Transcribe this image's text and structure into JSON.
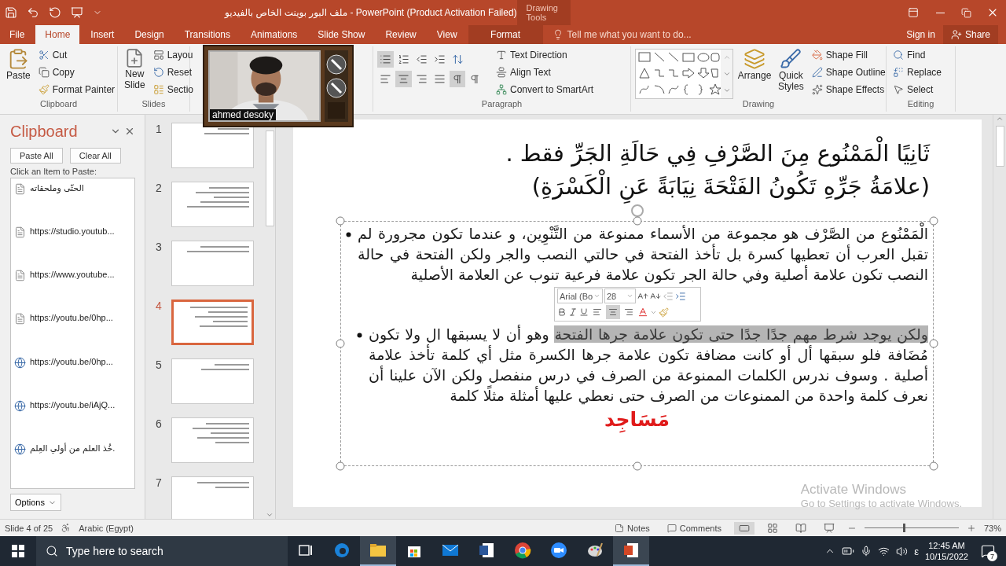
{
  "window": {
    "title": "ملف البور بوينت الخاص بالفيديو - PowerPoint (Product Activation Failed)",
    "context_group": "Drawing Tools"
  },
  "tabs": [
    {
      "label": "File",
      "kind": "file",
      "selected": false
    },
    {
      "label": "Home",
      "kind": "normal",
      "selected": true
    },
    {
      "label": "Insert",
      "kind": "normal",
      "selected": false
    },
    {
      "label": "Design",
      "kind": "normal",
      "selected": false
    },
    {
      "label": "Transitions",
      "kind": "normal",
      "selected": false
    },
    {
      "label": "Animations",
      "kind": "normal",
      "selected": false
    },
    {
      "label": "Slide Show",
      "kind": "normal",
      "selected": false
    },
    {
      "label": "Review",
      "kind": "normal",
      "selected": false
    },
    {
      "label": "View",
      "kind": "normal",
      "selected": false
    },
    {
      "label": "Format",
      "kind": "context",
      "selected": false
    }
  ],
  "tell_me": "Tell me what you want to do...",
  "account": {
    "sign_in": "Sign in",
    "share": "Share"
  },
  "ribbon": {
    "clipboard": {
      "label": "Clipboard",
      "paste": "Paste",
      "cut": "Cut",
      "copy": "Copy",
      "format_painter": "Format Painter"
    },
    "slides": {
      "label": "Slides",
      "new_slide": "New Slide",
      "layout": "Layou",
      "reset": "Reset",
      "section": "Sectio"
    },
    "paragraph": {
      "label": "Paragraph",
      "bullets_on": true,
      "alignments": [
        {
          "selected": false
        },
        {
          "selected": true
        },
        {
          "selected": false
        },
        {
          "selected": false
        }
      ],
      "directions": [
        {
          "selected": true
        },
        {
          "selected": false
        }
      ],
      "text_direction": "Text Direction",
      "align_text": "Align Text",
      "smartart": "Convert to SmartArt"
    },
    "drawing": {
      "label": "Drawing",
      "arrange": "Arrange",
      "quick_styles": "Quick Styles",
      "shape_fill": "Shape Fill",
      "shape_outline": "Shape Outline",
      "shape_effects": "Shape Effects"
    },
    "editing": {
      "label": "Editing",
      "find": "Find",
      "replace": "Replace",
      "select": "Select"
    }
  },
  "webcam": {
    "name": "ahmed desoky"
  },
  "clipboard_pane": {
    "title": "Clipboard",
    "paste_all": "Paste All",
    "clear_all": "Clear All",
    "hint": "Click an Item to Paste:",
    "options": "Options",
    "items": [
      {
        "kind": "text",
        "label": "الحتّى وملحقاته"
      },
      {
        "kind": "text",
        "label": "https://studio.youtub..."
      },
      {
        "kind": "text",
        "label": "https://www.youtube..."
      },
      {
        "kind": "text",
        "label": "https://youtu.be/0hp..."
      },
      {
        "kind": "web",
        "label": "https://youtu.be/0hp..."
      },
      {
        "kind": "web",
        "label": "https://youtu.be/iAjQ..."
      },
      {
        "kind": "web",
        "label": "خُذ العلم من أولي العِلم."
      }
    ]
  },
  "slides": [
    {
      "number": "1",
      "selected": false
    },
    {
      "number": "2",
      "selected": false
    },
    {
      "number": "3",
      "selected": false
    },
    {
      "number": "4",
      "selected": true
    },
    {
      "number": "5",
      "selected": false
    },
    {
      "number": "6",
      "selected": false
    },
    {
      "number": "7",
      "selected": false
    }
  ],
  "slide": {
    "title_lines": [
      "ثَانِيًا الْمَمْنُوع مِنَ الصَّرْفِ فِي حَالَةِ الجَرِّ فقط .",
      "(علامَةُ جَرِّهِ تَكُونُ الفَتْحَةَ نِيَابَةً عَنِ الْكَسْرَةِ)"
    ],
    "bullets": [
      {
        "text": "الْمَمْنُوع من الصَّرْف هو مجموعة من الأسماء ممنوعة من التَّنْوِين، و عندما تكون مجرورة لم تقبل العرب أن تعطيها كسرة بل تأخذ الفتحة في حالتي النصب والجر ولكن الفتحة في حالة النصب تكون علامة أصلية وفي حالة الجر تكون علامة فرعية تنوب عن العلامة الأصلية"
      },
      {
        "selected_text": "ولكن يوجد شرط مهم جدًا جدًا حتى تكون علامة جرها الفتحة",
        "text": " وهو أن لا يسبقها ال ولا تكون مُضَافة فلو سبقها أل أو كانت مضافة تكون علامة جرها الكسرة مثل أي كلمة تأخذ علامة أصلية . وسوف ندرس الكلمات الممنوعة من الصرف في درس منفصل ولكن الآن علينا أن نعرف كلمة واحدة من الممنوعات من الصرف حتى نعطي عليها أمثلة مثلًا كلمة"
      }
    ],
    "example_word": "مَسَاجِد"
  },
  "mini_toolbar": {
    "font": "Arial (Bo",
    "size": "28",
    "alignments": [
      {
        "selected": false
      },
      {
        "selected": true
      },
      {
        "selected": false
      }
    ]
  },
  "activation_notice": {
    "title": "Activate Windows",
    "subtitle": "Go to Settings to activate Windows."
  },
  "status_bar": {
    "slide": "Slide 4 of 25",
    "language": "Arabic (Egypt)",
    "notes": "Notes",
    "comments": "Comments",
    "zoom": "73%",
    "zoom_slider": {
      "level": 0.41
    }
  },
  "taskbar": {
    "search_placeholder": "Type here to search",
    "apps": [
      {
        "kind": "task-view",
        "active": false
      },
      {
        "kind": "edge",
        "active": false
      },
      {
        "kind": "explorer",
        "active": true
      },
      {
        "kind": "store",
        "active": false
      },
      {
        "kind": "mail",
        "active": false
      },
      {
        "kind": "word",
        "active": false
      },
      {
        "kind": "chrome",
        "active": false
      },
      {
        "kind": "zoom",
        "active": false
      },
      {
        "kind": "paint",
        "active": false
      },
      {
        "kind": "powerpoint",
        "active": true
      }
    ],
    "input_language": "ε",
    "time": "12:45 AM",
    "date": "10/15/2022",
    "notifications": "7"
  }
}
